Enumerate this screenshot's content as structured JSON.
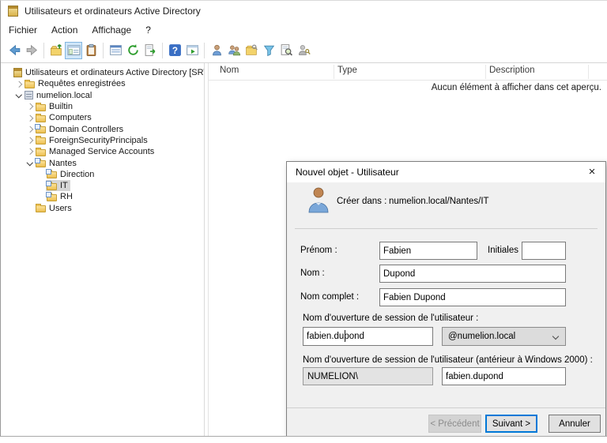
{
  "window": {
    "title": "Utilisateurs et ordinateurs Active Directory"
  },
  "menu": {
    "items": [
      "Fichier",
      "Action",
      "Affichage",
      "?"
    ]
  },
  "toolbar": {
    "icons": [
      "back",
      "forward",
      "up-one-level",
      "show-console-tree",
      "properties",
      "list-view",
      "refresh",
      "export-list",
      "help",
      "show-action-pane",
      "new-user",
      "new-group",
      "add-to-group",
      "filter",
      "find",
      "user-key"
    ]
  },
  "tree": {
    "items": [
      {
        "label": "Utilisateurs et ordinateurs Active Directory [SRV-A"
      },
      {
        "label": "Requêtes enregistrées"
      },
      {
        "label": "numelion.local"
      },
      {
        "label": "Builtin"
      },
      {
        "label": "Computers"
      },
      {
        "label": "Domain Controllers"
      },
      {
        "label": "ForeignSecurityPrincipals"
      },
      {
        "label": "Managed Service Accounts"
      },
      {
        "label": "Nantes"
      },
      {
        "label": "Direction"
      },
      {
        "label": "IT"
      },
      {
        "label": "RH"
      },
      {
        "label": "Users"
      }
    ]
  },
  "list": {
    "columns": [
      "Nom",
      "Type",
      "Description"
    ],
    "empty_message": "Aucun élément à afficher dans cet aperçu."
  },
  "dialog": {
    "title": "Nouvel objet - Utilisateur",
    "close_glyph": "×",
    "create_in_label": "Créer dans :",
    "create_in_value": "numelion.local/Nantes/IT",
    "fields": {
      "first_name_label": "Prénom :",
      "first_name_value": "Fabien",
      "initials_label": "Initiales :",
      "initials_value": "",
      "last_name_label": "Nom :",
      "last_name_value": "Dupond",
      "full_name_label": "Nom complet :",
      "full_name_value": "Fabien Dupond",
      "logon_label": "Nom d'ouverture de session de l'utilisateur :",
      "logon_value": "fabien.dupond",
      "upn_suffix": "@numelion.local",
      "legacy_logon_label": "Nom d'ouverture de session de l'utilisateur (antérieur à Windows 2000) :",
      "legacy_domain": "NUMELION\\",
      "legacy_logon_value": "fabien.dupond"
    },
    "buttons": {
      "back": "< Précédent",
      "next": "Suivant >",
      "cancel": "Annuler"
    }
  },
  "colors": {
    "accent": "#0078d7",
    "folder": "#eec75a",
    "inactive_selection": "#d6d6d6",
    "toolbar_highlight": "#cfe6f9"
  }
}
